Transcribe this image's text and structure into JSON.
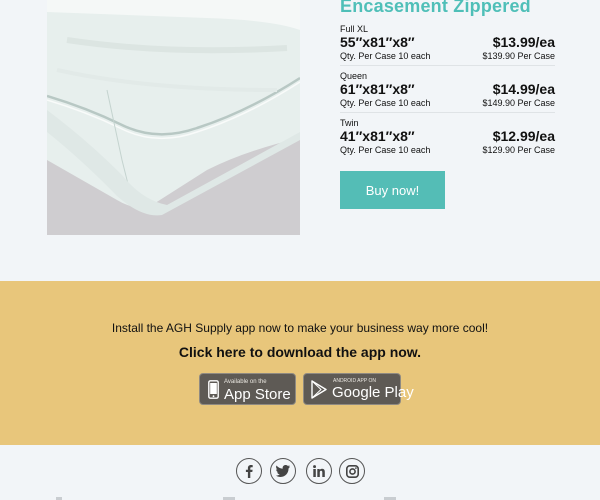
{
  "product": {
    "title": "Encasement Zippered",
    "variants": [
      {
        "size": "Full XL",
        "dimensions": "55″x81″x8″",
        "qty": "Qty. Per Case 10 each",
        "price": "$13.99/ea",
        "case_price": "$139.90 Per Case"
      },
      {
        "size": "Queen",
        "dimensions": "61″x81″x8″",
        "qty": "Qty. Per Case 10 each",
        "price": "$14.99/ea",
        "case_price": "$149.90 Per Case"
      },
      {
        "size": "Twin",
        "dimensions": "41″x81″x8″",
        "qty": "Qty. Per Case 10 each",
        "price": "$12.99/ea",
        "case_price": "$129.90 Per Case"
      }
    ],
    "buy_label": "Buy now!"
  },
  "banner": {
    "line1": "Install the AGH Supply app now to make your business way more cool!",
    "line2": "Click here to download the app now.",
    "app_store_small": "Available on the",
    "app_store_big": "App Store",
    "google_play_small": "ANDROID APP ON",
    "google_play_big": "Google Play"
  },
  "social": {
    "icons": [
      "facebook-icon",
      "twitter-icon",
      "linkedin-icon",
      "instagram-icon"
    ]
  },
  "colors": {
    "accent": "#4fbfb8",
    "button": "#54bdb6",
    "banner": "#e8c67b",
    "background": "#f2f5f8"
  }
}
